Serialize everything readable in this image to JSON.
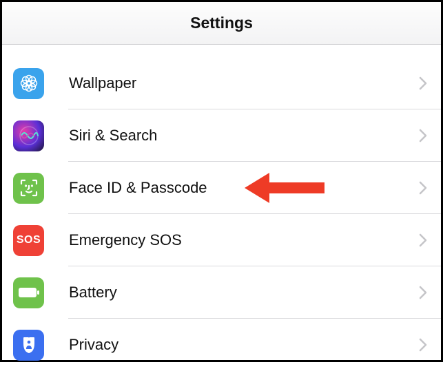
{
  "header": {
    "title": "Settings"
  },
  "rows": [
    {
      "id": "wallpaper",
      "label": "Wallpaper"
    },
    {
      "id": "siri-search",
      "label": "Siri & Search"
    },
    {
      "id": "face-id-passcode",
      "label": "Face ID & Passcode",
      "highlighted": true
    },
    {
      "id": "emergency-sos",
      "label": "Emergency SOS"
    },
    {
      "id": "battery",
      "label": "Battery"
    },
    {
      "id": "privacy",
      "label": "Privacy"
    }
  ],
  "annotation": {
    "arrow_color": "#ee3b26"
  },
  "sos_text": "SOS"
}
